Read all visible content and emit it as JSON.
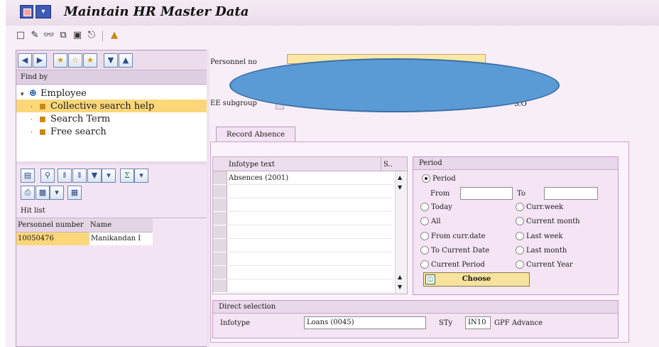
{
  "window": {
    "title": "Maintain HR Master Data"
  },
  "system_menu": {
    "dropdown_glyph": "▾"
  },
  "toolbar": {
    "icons": [
      "create-icon",
      "change-icon",
      "display-icon",
      "copy-icon",
      "delimit-icon",
      "delete-icon",
      "overview-icon"
    ]
  },
  "navigation": {
    "find_by_label": "Find by",
    "tree": {
      "employee": "Employee",
      "collective_search_help": "Collective search help",
      "search_term": "Search Term",
      "free_search": "Free search"
    }
  },
  "hit_list": {
    "label": "Hit list",
    "columns": [
      "Personnel number",
      "Name"
    ],
    "rows": [
      {
        "personnel_number": "10050476",
        "name": "Manikandan I"
      }
    ]
  },
  "header": {
    "personnel_no_label": "Personnel no",
    "ee_subgroup_label": "EE subgroup",
    "partial_text": "S.O",
    "obscured": true
  },
  "tab": {
    "label": "Record Absence"
  },
  "infotype_grid": {
    "columns": [
      "Infotype text",
      "S.."
    ],
    "rows": [
      "Absences (2001)"
    ]
  },
  "period": {
    "title": "Period",
    "options": {
      "period": "Period",
      "today": "Today",
      "curr_week": "Curr.week",
      "all": "All",
      "current_month": "Current month",
      "from_curr_date": "From curr.date",
      "last_week": "Last week",
      "to_current_date": "To Current Date",
      "last_month": "Last month",
      "current_period": "Current Period",
      "current_year": "Current Year"
    },
    "selected": "period",
    "from_label": "From",
    "to_label": "To",
    "from_value": "",
    "to_value": "",
    "choose_label": "Choose"
  },
  "direct_selection": {
    "title": "Direct selection",
    "infotype_label": "Infotype",
    "infotype_value": "Loans (0045)",
    "sty_label": "STy",
    "sty_value": "IN10",
    "sty_text": "GPF Advance"
  },
  "colors": {
    "frame_bg": "#f7eef7",
    "selected_node_bg": "#fbd77a",
    "ellipse_fill": "#5b9bd5",
    "choose_button_bg": "#f7e39e"
  }
}
